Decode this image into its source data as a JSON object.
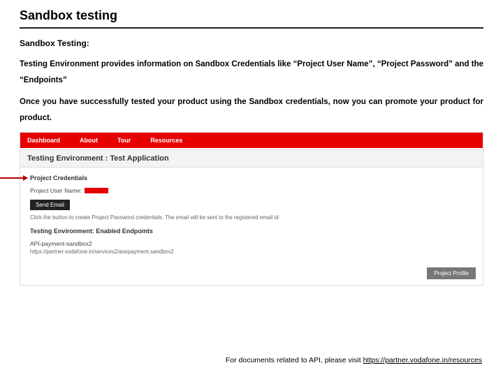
{
  "title": "Sandbox testing",
  "section_heading": "Sandbox Testing:",
  "paragraph1": "Testing Environment provides information on Sandbox Credentials like “Project User Name”, “Project Password” and the “Endpoints”",
  "paragraph2": "Once you have successfully tested your product using the Sandbox credentials, now you can promote your product for product.",
  "nav": {
    "items": [
      "Dashboard",
      "About",
      "Tour",
      "Resources"
    ]
  },
  "env_title": "Testing Environment : Test Application",
  "credentials": {
    "heading": "Project Credentials",
    "user_label": "Project User Name:",
    "send_btn": "Send Email",
    "hint": "Click the button to create Project Password credentials. The email will be sent to the registered email id"
  },
  "endpoints": {
    "heading": "Testing Environment: Enabled Endpoints",
    "name": "API-payment-sandbox2",
    "url": "https://partner.vodafone.in/services2/asepayment.sandbox2"
  },
  "profile_btn": "Project Profile",
  "footer": {
    "prefix": "For documents related to API, please visit ",
    "link": "https://partner.vodafone.in/resources"
  }
}
